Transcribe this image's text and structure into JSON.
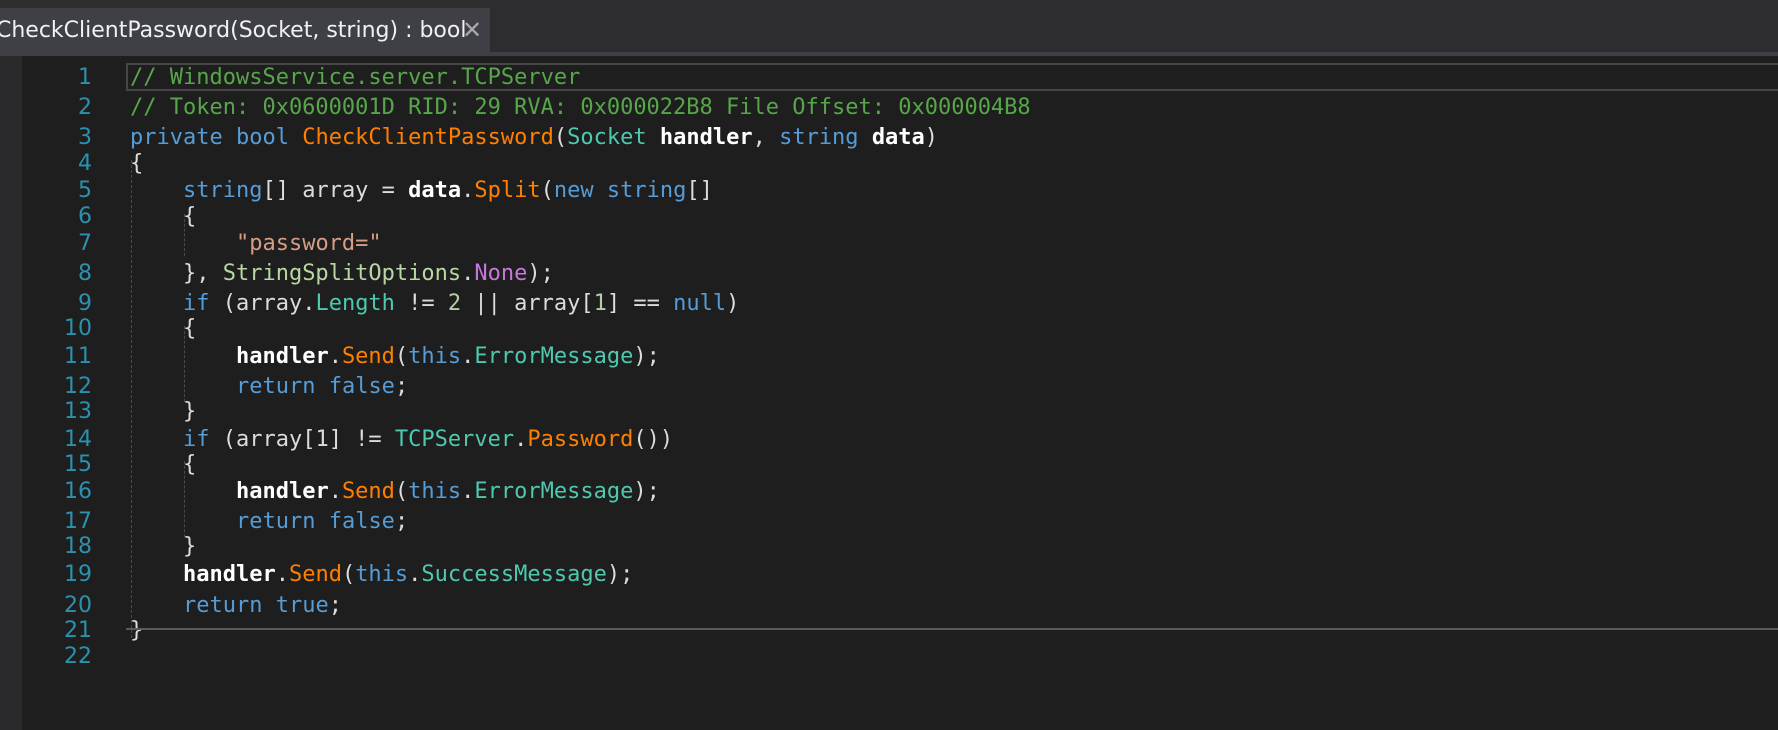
{
  "tab": {
    "title": "CheckClientPassword(Socket, string) : bool",
    "close_glyph": "✕"
  },
  "colors": {
    "comment": "#57a64a",
    "keyword": "#569cd6",
    "type": "#4ec9b0",
    "method": "#ff8000",
    "param": "#ffffff",
    "string": "#d69d85",
    "number": "#b5cea8",
    "enum_member": "#b8d7a3",
    "enum_value": "#c678dd",
    "plain": "#dcdcdc",
    "line_number": "#2b91af"
  },
  "lines": [
    {
      "n": "1",
      "tokens": [
        {
          "t": "// WindowsService.server.TCPServer",
          "c": "comment"
        }
      ]
    },
    {
      "n": "2",
      "tokens": [
        {
          "t": "// Token: 0x0600001D RID: 29 RVA: 0x000022B8 File Offset: 0x000004B8",
          "c": "comment"
        }
      ]
    },
    {
      "n": "3",
      "tokens": [
        {
          "t": "private",
          "c": "keyword"
        },
        {
          "t": " ",
          "c": "plain"
        },
        {
          "t": "bool",
          "c": "keyword"
        },
        {
          "t": " ",
          "c": "plain"
        },
        {
          "t": "CheckClientPassword",
          "c": "method"
        },
        {
          "t": "(",
          "c": "plain"
        },
        {
          "t": "Socket",
          "c": "type"
        },
        {
          "t": " ",
          "c": "plain"
        },
        {
          "t": "handler",
          "c": "param"
        },
        {
          "t": ", ",
          "c": "plain"
        },
        {
          "t": "string",
          "c": "keyword"
        },
        {
          "t": " ",
          "c": "plain"
        },
        {
          "t": "data",
          "c": "param"
        },
        {
          "t": ")",
          "c": "plain"
        }
      ]
    },
    {
      "n": "4",
      "tokens": [
        {
          "t": "{",
          "c": "plain"
        }
      ]
    },
    {
      "n": "5",
      "tokens": [
        {
          "t": "    ",
          "c": "plain"
        },
        {
          "t": "string",
          "c": "keyword"
        },
        {
          "t": "[] array = ",
          "c": "plain"
        },
        {
          "t": "data",
          "c": "param"
        },
        {
          "t": ".",
          "c": "plain"
        },
        {
          "t": "Split",
          "c": "method"
        },
        {
          "t": "(",
          "c": "plain"
        },
        {
          "t": "new",
          "c": "keyword"
        },
        {
          "t": " ",
          "c": "plain"
        },
        {
          "t": "string",
          "c": "keyword"
        },
        {
          "t": "[]",
          "c": "plain"
        }
      ]
    },
    {
      "n": "6",
      "tokens": [
        {
          "t": "    {",
          "c": "plain"
        }
      ]
    },
    {
      "n": "7",
      "tokens": [
        {
          "t": "        ",
          "c": "plain"
        },
        {
          "t": "\"password=\"",
          "c": "string"
        }
      ]
    },
    {
      "n": "8",
      "tokens": [
        {
          "t": "    }, ",
          "c": "plain"
        },
        {
          "t": "StringSplitOptions",
          "c": "enum_member"
        },
        {
          "t": ".",
          "c": "plain"
        },
        {
          "t": "None",
          "c": "enum_value"
        },
        {
          "t": ");",
          "c": "plain"
        }
      ]
    },
    {
      "n": "9",
      "tokens": [
        {
          "t": "    ",
          "c": "plain"
        },
        {
          "t": "if",
          "c": "keyword"
        },
        {
          "t": " (array.",
          "c": "plain"
        },
        {
          "t": "Length",
          "c": "type"
        },
        {
          "t": " != ",
          "c": "plain"
        },
        {
          "t": "2",
          "c": "number"
        },
        {
          "t": " || array[",
          "c": "plain"
        },
        {
          "t": "1",
          "c": "number"
        },
        {
          "t": "] == ",
          "c": "plain"
        },
        {
          "t": "null",
          "c": "keyword"
        },
        {
          "t": ")",
          "c": "plain"
        }
      ]
    },
    {
      "n": "10",
      "tokens": [
        {
          "t": "    {",
          "c": "plain"
        }
      ]
    },
    {
      "n": "11",
      "tokens": [
        {
          "t": "        ",
          "c": "plain"
        },
        {
          "t": "handler",
          "c": "param"
        },
        {
          "t": ".",
          "c": "plain"
        },
        {
          "t": "Send",
          "c": "method"
        },
        {
          "t": "(",
          "c": "plain"
        },
        {
          "t": "this",
          "c": "keyword"
        },
        {
          "t": ".",
          "c": "plain"
        },
        {
          "t": "ErrorMessage",
          "c": "type"
        },
        {
          "t": ");",
          "c": "plain"
        }
      ]
    },
    {
      "n": "12",
      "tokens": [
        {
          "t": "        ",
          "c": "plain"
        },
        {
          "t": "return",
          "c": "keyword"
        },
        {
          "t": " ",
          "c": "plain"
        },
        {
          "t": "false",
          "c": "keyword"
        },
        {
          "t": ";",
          "c": "plain"
        }
      ]
    },
    {
      "n": "13",
      "tokens": [
        {
          "t": "    }",
          "c": "plain"
        }
      ]
    },
    {
      "n": "14",
      "tokens": [
        {
          "t": "    ",
          "c": "plain"
        },
        {
          "t": "if",
          "c": "keyword"
        },
        {
          "t": " (array[1] != ",
          "c": "plain"
        },
        {
          "t": "TCPServer",
          "c": "type"
        },
        {
          "t": ".",
          "c": "plain"
        },
        {
          "t": "Password",
          "c": "method"
        },
        {
          "t": "())",
          "c": "plain"
        }
      ]
    },
    {
      "n": "15",
      "tokens": [
        {
          "t": "    {",
          "c": "plain"
        }
      ]
    },
    {
      "n": "16",
      "tokens": [
        {
          "t": "        ",
          "c": "plain"
        },
        {
          "t": "handler",
          "c": "param"
        },
        {
          "t": ".",
          "c": "plain"
        },
        {
          "t": "Send",
          "c": "method"
        },
        {
          "t": "(",
          "c": "plain"
        },
        {
          "t": "this",
          "c": "keyword"
        },
        {
          "t": ".",
          "c": "plain"
        },
        {
          "t": "ErrorMessage",
          "c": "type"
        },
        {
          "t": ");",
          "c": "plain"
        }
      ]
    },
    {
      "n": "17",
      "tokens": [
        {
          "t": "        ",
          "c": "plain"
        },
        {
          "t": "return",
          "c": "keyword"
        },
        {
          "t": " ",
          "c": "plain"
        },
        {
          "t": "false",
          "c": "keyword"
        },
        {
          "t": ";",
          "c": "plain"
        }
      ]
    },
    {
      "n": "18",
      "tokens": [
        {
          "t": "    }",
          "c": "plain"
        }
      ]
    },
    {
      "n": "19",
      "tokens": [
        {
          "t": "    ",
          "c": "plain"
        },
        {
          "t": "handler",
          "c": "param"
        },
        {
          "t": ".",
          "c": "plain"
        },
        {
          "t": "Send",
          "c": "method"
        },
        {
          "t": "(",
          "c": "plain"
        },
        {
          "t": "this",
          "c": "keyword"
        },
        {
          "t": ".",
          "c": "plain"
        },
        {
          "t": "SuccessMessage",
          "c": "type"
        },
        {
          "t": ");",
          "c": "plain"
        }
      ]
    },
    {
      "n": "20",
      "tokens": [
        {
          "t": "    ",
          "c": "plain"
        },
        {
          "t": "return",
          "c": "keyword"
        },
        {
          "t": " ",
          "c": "plain"
        },
        {
          "t": "true",
          "c": "keyword"
        },
        {
          "t": ";",
          "c": "plain"
        }
      ]
    },
    {
      "n": "21",
      "tokens": [
        {
          "t": "}",
          "c": "plain"
        }
      ]
    },
    {
      "n": "22",
      "tokens": []
    }
  ]
}
